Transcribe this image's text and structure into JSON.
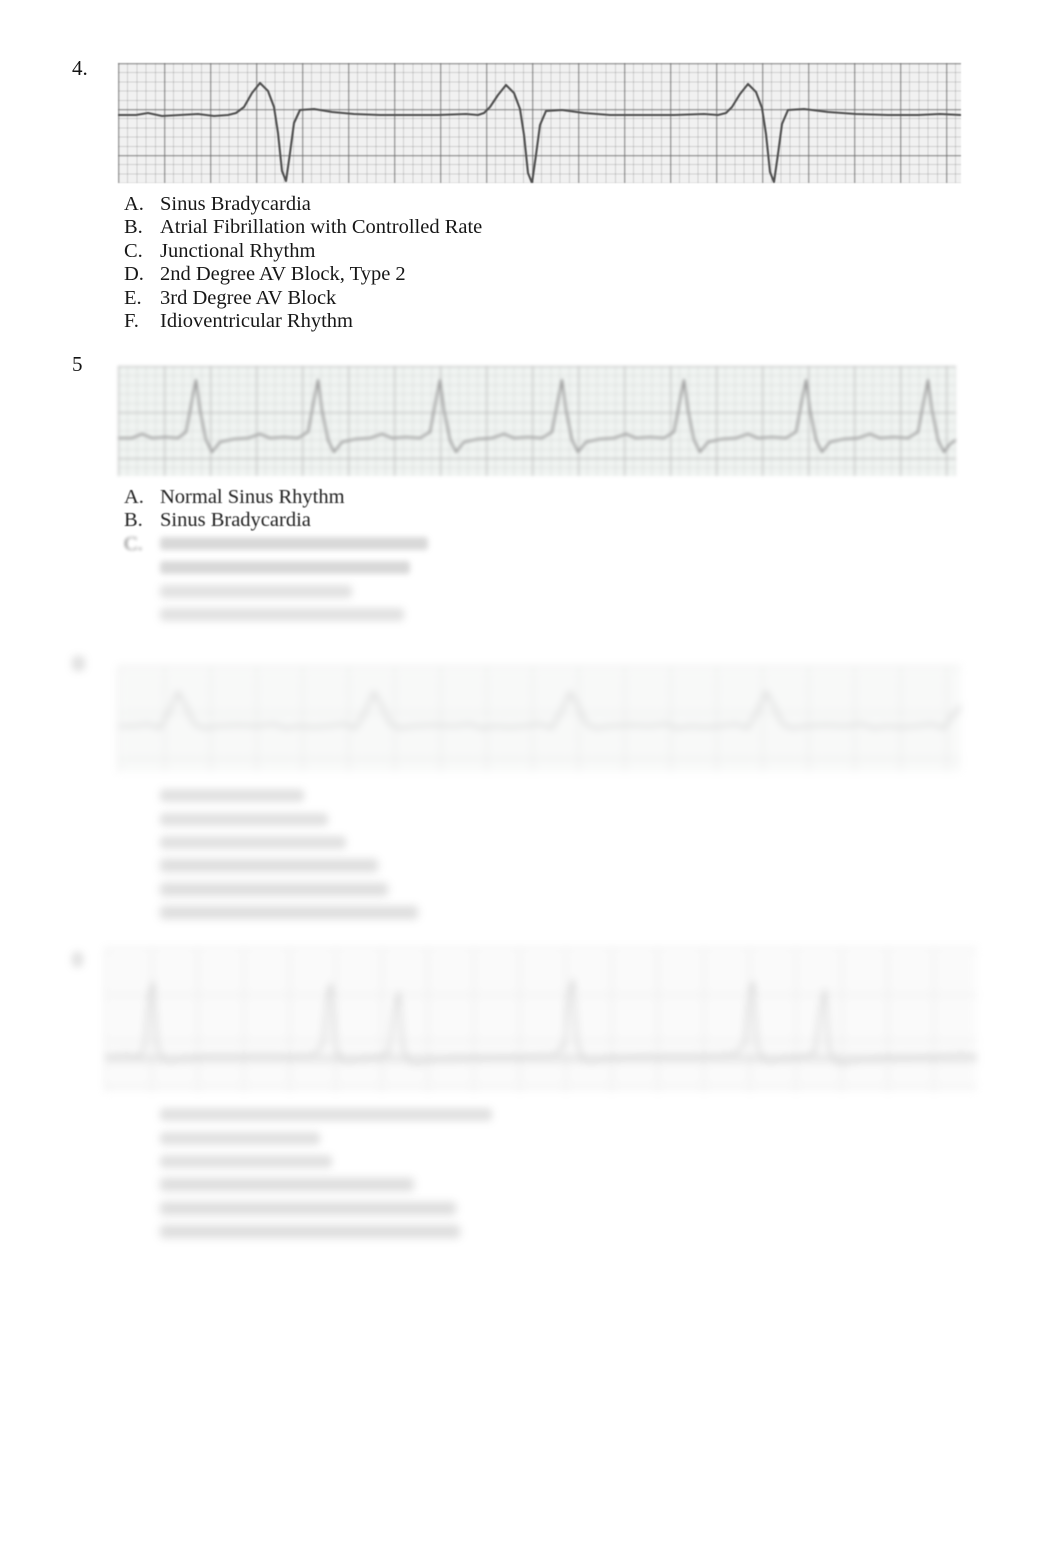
{
  "document": {
    "type": "ecg-rhythm-identification-quiz",
    "page_background": "#ffffff",
    "legible_note": "Lower portion of page is progressively blurred and illegible"
  },
  "questions": [
    {
      "number": "4.",
      "legible": true,
      "strip": {
        "name": "ecg-strip-4",
        "tint": "#f1f1f1",
        "rhythm_visual": "slow wide-complex beats, 3 QRS across strip, very slow rate"
      },
      "options": [
        {
          "letter": "A.",
          "label": "Sinus Bradycardia"
        },
        {
          "letter": "B.",
          "label": "Atrial Fibrillation with Controlled Rate"
        },
        {
          "letter": "C.",
          "label": "Junctional Rhythm"
        },
        {
          "letter": "D.",
          "label": "2nd Degree AV Block, Type 2"
        },
        {
          "letter": "E.",
          "label": "3rd Degree AV Block"
        },
        {
          "letter": "F.",
          "label": "Idioventricular Rhythm"
        }
      ]
    },
    {
      "number": "5",
      "legible": "partial",
      "strip": {
        "name": "ecg-strip-5",
        "tint": "#e4ebe7",
        "rhythm_visual": "regular narrow QRS complexes, moderate rate"
      },
      "options": [
        {
          "letter": "A.",
          "label": "Normal Sinus Rhythm",
          "legible": true
        },
        {
          "letter": "B.",
          "label": "Sinus Bradycardia",
          "legible": true
        },
        {
          "letter": "C.",
          "label": "",
          "legible": false
        },
        {
          "letter": "",
          "label": "",
          "legible": false
        },
        {
          "letter": "",
          "label": "",
          "legible": false
        },
        {
          "letter": "",
          "label": "",
          "legible": false
        }
      ]
    },
    {
      "number": "",
      "legible": false,
      "strip": {
        "name": "ecg-strip-6",
        "tint": "#eef2ef",
        "rhythm_visual": "low amplitude complexes, wandering baseline"
      },
      "options": [
        {
          "letter": "",
          "label": "",
          "legible": false
        },
        {
          "letter": "",
          "label": "",
          "legible": false
        },
        {
          "letter": "",
          "label": "",
          "legible": false
        },
        {
          "letter": "",
          "label": "",
          "legible": false
        },
        {
          "letter": "",
          "label": "",
          "legible": false
        },
        {
          "letter": "",
          "label": "",
          "legible": false
        }
      ]
    },
    {
      "number": "",
      "legible": false,
      "strip": {
        "name": "ecg-strip-7",
        "tint": "#f6f6f6",
        "rhythm_visual": "tall narrow spiked QRS complexes on dark baseline"
      },
      "options": [
        {
          "letter": "",
          "label": "",
          "legible": false
        },
        {
          "letter": "",
          "label": "",
          "legible": false
        },
        {
          "letter": "",
          "label": "",
          "legible": false
        },
        {
          "letter": "",
          "label": "",
          "legible": false
        },
        {
          "letter": "",
          "label": "",
          "legible": false
        },
        {
          "letter": "",
          "label": "",
          "legible": false
        }
      ]
    }
  ]
}
